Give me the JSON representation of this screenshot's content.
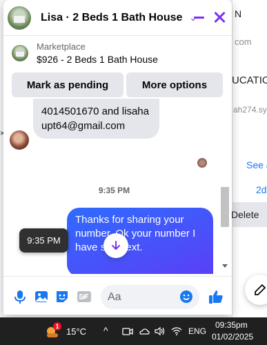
{
  "background_page": {
    "top_text": "N",
    "domain_text": "com",
    "heading_fragment": "UCATIO",
    "email_fragment": "ah274.sy",
    "see_link": "See a",
    "time_fragment": "2d",
    "delete_label": "Delete",
    "close_x": "×"
  },
  "chat": {
    "title": "Lisa · 2 Beds 1 Bath House",
    "chevron": "⌄",
    "accent_color": "#7b2ff7",
    "marketplace": {
      "label": "Marketplace",
      "listing": "$926 - 2 Beds 1 Bath House",
      "mark_pending_label": "Mark as pending",
      "more_options_label": "More options"
    },
    "messages": {
      "incoming_text": "4014501670 and lisahaupt64@gmail.com",
      "timestamp": "9:35 PM",
      "outgoing_text": "Thanks for sharing your number. Ok your number I have sent text.",
      "tooltip_time": "9:35 PM"
    },
    "composer": {
      "placeholder": "Aa",
      "icons": [
        "microphone-icon",
        "photo-icon",
        "sticker-icon",
        "gif-icon",
        "emoji-icon",
        "like-icon"
      ]
    }
  },
  "taskbar": {
    "weather_badge": "1",
    "temperature": "15°C",
    "tray_chevron": "^",
    "language": "ENG",
    "time": "09:35pm",
    "date": "01/02/2025"
  }
}
